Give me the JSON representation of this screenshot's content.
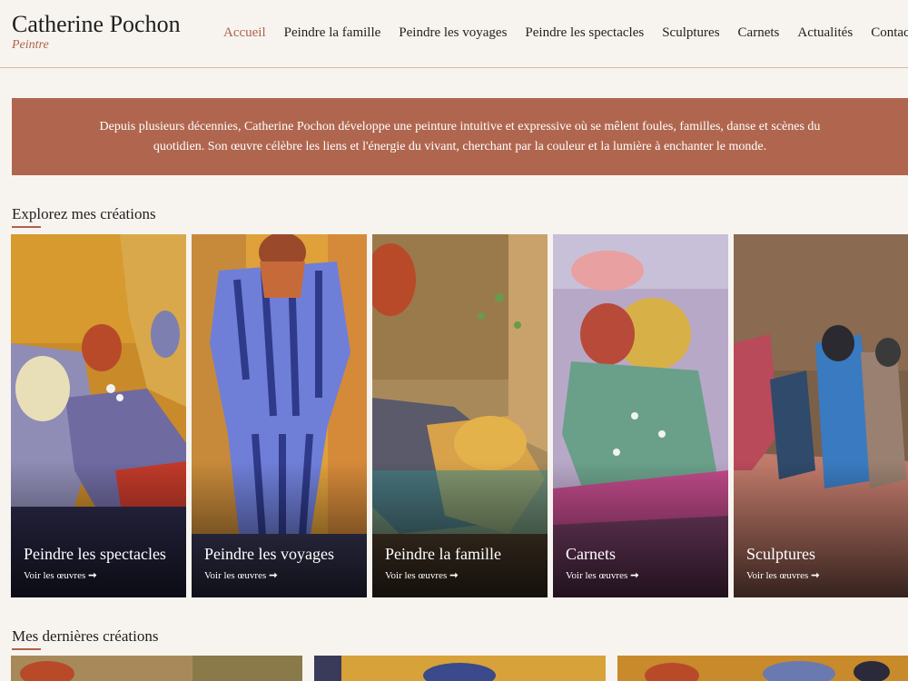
{
  "header": {
    "brand": "Catherine Pochon",
    "subtitle": "Peintre",
    "nav": [
      "Accueil",
      "Peindre la famille",
      "Peindre les voyages",
      "Peindre les spectacles",
      "Sculptures",
      "Carnets",
      "Actualités",
      "Contact"
    ]
  },
  "banner": {
    "text": "Depuis plusieurs décennies, Catherine Pochon développe une peinture intuitive et expressive où se mêlent foules, familles, danse et scènes du quotidien. Son œuvre célèbre les liens et l'énergie du vivant, cherchant par la couleur et la lumière à enchanter le monde."
  },
  "explore": {
    "title": "Explorez mes créations",
    "cards": [
      {
        "title": "Peindre les spectacles",
        "link": "Voir les œuvres"
      },
      {
        "title": "Peindre les voyages",
        "link": "Voir les œuvres"
      },
      {
        "title": "Peindre la famille",
        "link": "Voir les œuvres"
      },
      {
        "title": "Carnets",
        "link": "Voir les œuvres"
      },
      {
        "title": "Sculptures",
        "link": "Voir les œuvres"
      }
    ]
  },
  "latest": {
    "title": "Mes dernières créations"
  },
  "colors": {
    "accent": "#b0614a",
    "banner_bg": "#b0664e",
    "page_bg": "#f7f4ef"
  }
}
